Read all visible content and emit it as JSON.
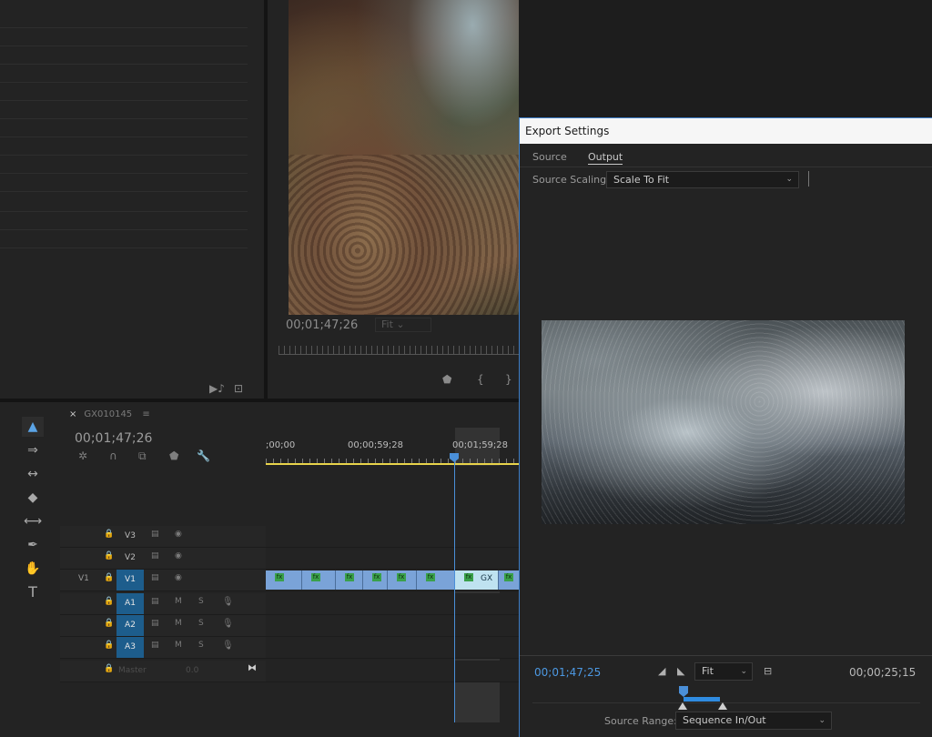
{
  "program_monitor": {
    "timecode": "00;01;47;26",
    "fit_label": "Fit",
    "in_label": "{",
    "out_label": "}"
  },
  "timeline": {
    "tab_close": "×",
    "sequence_name": "GX010145",
    "menu_glyph": "≡",
    "timecode": "00;01;47;26",
    "ruler_labels": [
      ";00;00",
      "00;00;59;28",
      "00;01;59;28"
    ],
    "tracks": [
      {
        "outer": "",
        "name": "V3",
        "active": false,
        "icons": [
          "▤",
          "◉"
        ]
      },
      {
        "outer": "",
        "name": "V2",
        "active": false,
        "icons": [
          "▤",
          "◉"
        ]
      },
      {
        "outer": "V1",
        "name": "V1",
        "active": true,
        "icons": [
          "▤",
          "◉"
        ]
      },
      {
        "outer": "",
        "name": "A1",
        "active": true,
        "icons": [
          "▤",
          "M",
          "S",
          "🎙"
        ]
      },
      {
        "outer": "",
        "name": "A2",
        "active": true,
        "icons": [
          "▤",
          "M",
          "S",
          "🎙"
        ]
      },
      {
        "outer": "",
        "name": "A3",
        "active": true,
        "icons": [
          "▤",
          "M",
          "S",
          "🎙"
        ]
      }
    ],
    "master": {
      "label": "Master",
      "value": "0.0"
    },
    "clip_fx_label": "fx",
    "selected_clip_name": "GX"
  },
  "export_dialog": {
    "title": "Export Settings",
    "tabs": [
      "Source",
      "Output"
    ],
    "active_tab": "Output",
    "source_scaling_label": "Source Scaling:",
    "source_scaling_value": "Scale To Fit",
    "timecode_current": "00;01;47;25",
    "timecode_duration": "00;00;25;15",
    "fit_value": "Fit",
    "source_range_label": "Source Range:",
    "source_range_value": "Sequence In/Out"
  },
  "colors": {
    "accent_blue": "#4c98e2",
    "track_active": "#1d5d8c",
    "clip_video": "#7aa3d8",
    "clip_selected": "#bfe2f0",
    "fx_badge": "#3aa04a",
    "work_area": "#e8d34a"
  },
  "icons": {
    "tools": [
      "selection-icon",
      "track-select-icon",
      "ripple-edit-icon",
      "razor-icon",
      "slip-icon",
      "pen-icon",
      "hand-icon",
      "type-icon"
    ]
  }
}
